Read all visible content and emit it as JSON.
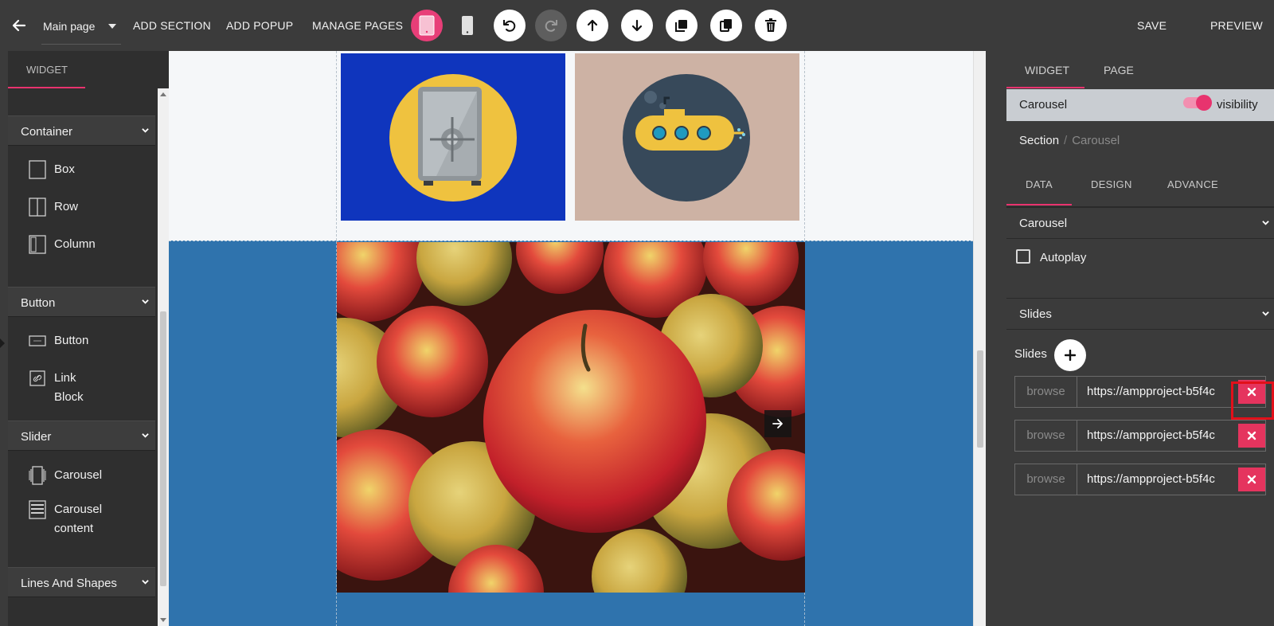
{
  "topbar": {
    "page_select": "Main page",
    "add_section": "ADD SECTION",
    "add_popup": "ADD POPUP",
    "manage_pages": "MANAGE PAGES",
    "save": "SAVE",
    "preview": "PREVIEW"
  },
  "left_panel": {
    "tab": "WIDGET",
    "categories": [
      {
        "label": "Container",
        "items": [
          "Box",
          "Row",
          "Column"
        ]
      },
      {
        "label": "Button",
        "items": [
          "Button",
          "Link Block"
        ]
      },
      {
        "label": "Slider",
        "items": [
          "Carousel",
          "Carousel content"
        ]
      },
      {
        "label": "Lines And Shapes",
        "items": []
      }
    ],
    "carousel_content_line1": "Carousel",
    "carousel_content_line2": "content"
  },
  "right_panel": {
    "tabs": [
      "WIDGET",
      "PAGE"
    ],
    "widget_name": "Carousel",
    "visibility_label": "visibility",
    "visibility_on": true,
    "breadcrumb": {
      "parent": "Section",
      "current": "Carousel"
    },
    "sub_tabs": [
      "DATA",
      "DESIGN",
      "ADVANCE"
    ],
    "accordion_carousel": "Carousel",
    "autoplay_label": "Autoplay",
    "autoplay_checked": false,
    "accordion_slides": "Slides",
    "slides_label": "Slides",
    "slides": [
      {
        "browse": "browse",
        "url": "https://ampproject-b5f4c"
      },
      {
        "browse": "browse",
        "url": "https://ampproject-b5f4c"
      },
      {
        "browse": "browse",
        "url": "https://ampproject-b5f4c"
      }
    ]
  },
  "colors": {
    "accent": "#e8336e",
    "delete": "#e5345e",
    "section_blue": "#2f73ad",
    "tile_blue": "#0f35bd",
    "tile_tan": "#cdb2a4"
  },
  "icons": [
    "back-arrow-icon",
    "tablet-icon",
    "mobile-icon",
    "undo-icon",
    "redo-icon",
    "move-up-icon",
    "move-down-icon",
    "duplicate-icon",
    "copy-icon",
    "trash-icon",
    "plus-icon",
    "close-icon",
    "arrow-right-icon"
  ]
}
